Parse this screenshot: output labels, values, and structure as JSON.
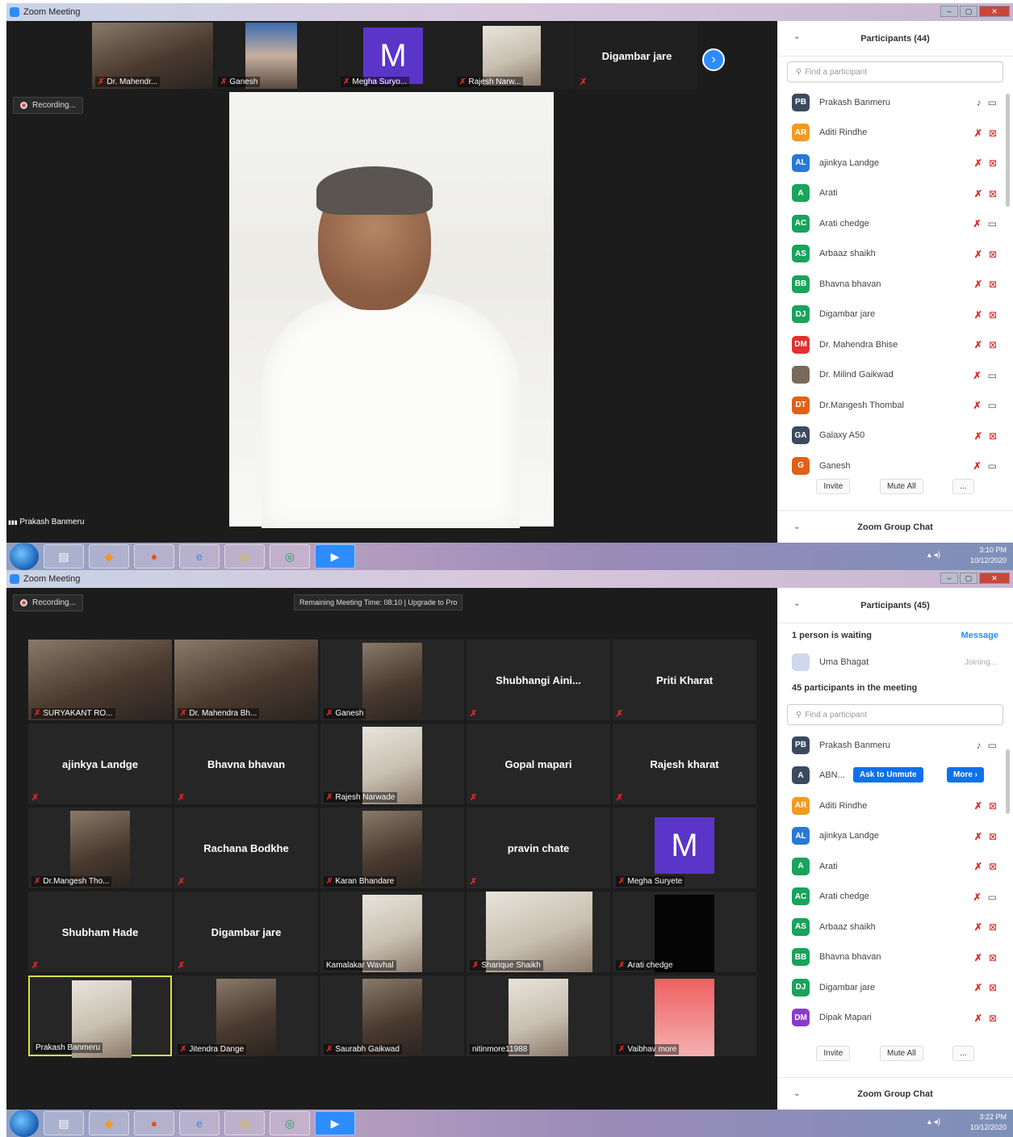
{
  "window_title": "Zoom Meeting",
  "window_controls": {
    "minimize": "–",
    "maximize": "▢",
    "close": "✕"
  },
  "taskbar": {
    "apps": [
      "start-orb",
      "file-manager",
      "vlc",
      "firefox",
      "internet-explorer",
      "chrome",
      "chrome-2",
      "zoom"
    ],
    "icons": {
      "file_manager": "▤",
      "vlc": "◆",
      "firefox": "●",
      "ie": "e",
      "chrome": "◎",
      "chrome2": "◎",
      "zoom": "▶"
    },
    "tray": "▴ ◂)",
    "clock1": {
      "time": "3:10 PM",
      "date": "10/12/2020"
    },
    "clock2": {
      "time": "3:22 PM",
      "date": "10/12/2020"
    }
  },
  "shot1": {
    "recording": "Recording...",
    "strip_tiles": [
      {
        "name": "Dr. Mahendr..."
      },
      {
        "name": "Ganesh"
      },
      {
        "name": "Megha Suryo..."
      },
      {
        "name": "Rajesh Narw..."
      },
      {
        "name": "Digambar jare"
      }
    ],
    "avatar_letter": "M",
    "next_icon": "›",
    "active_speaker": "Prakash Banmeru",
    "signal_icon": "▮▮▮",
    "panel": {
      "title": "Participants (44)",
      "search_placeholder": "Find a participant",
      "participants": [
        {
          "initials": "PB",
          "name": "Prakash Banmeru",
          "color": "#3b4a5e",
          "mic": "on",
          "video": "on"
        },
        {
          "initials": "AR",
          "name": "Aditi Rindhe",
          "color": "#f29a1f",
          "mic": "off",
          "video": "off"
        },
        {
          "initials": "AL",
          "name": "ajinkya Landge",
          "color": "#2779d4",
          "mic": "off",
          "video": "off"
        },
        {
          "initials": "A",
          "name": "Arati",
          "color": "#19a35b",
          "mic": "off",
          "video": "off"
        },
        {
          "initials": "AC",
          "name": "Arati chedge",
          "color": "#19a35b",
          "mic": "off",
          "video": "on"
        },
        {
          "initials": "AS",
          "name": "Arbaaz shaikh",
          "color": "#19a35b",
          "mic": "off",
          "video": "off"
        },
        {
          "initials": "BB",
          "name": "Bhavna bhavan",
          "color": "#19a35b",
          "mic": "off",
          "video": "off"
        },
        {
          "initials": "DJ",
          "name": "Digambar jare",
          "color": "#19a35b",
          "mic": "off",
          "video": "off"
        },
        {
          "initials": "DM",
          "name": "Dr. Mahendra Bhise",
          "color": "#e03030",
          "mic": "off",
          "video": "off"
        },
        {
          "initials": "",
          "name": "Dr. Milind Gaikwad",
          "color": "#7a6a5a",
          "mic": "off",
          "video": "on"
        },
        {
          "initials": "DT",
          "name": "Dr.Mangesh Thombal",
          "color": "#e06018",
          "mic": "off",
          "video": "on"
        },
        {
          "initials": "GA",
          "name": "Galaxy A50",
          "color": "#3b4a5e",
          "mic": "off",
          "video": "off"
        },
        {
          "initials": "G",
          "name": "Ganesh",
          "color": "#e06018",
          "mic": "off",
          "video": "on"
        }
      ],
      "invite": "Invite",
      "mute_all": "Mute All",
      "more": "...",
      "chat": "Zoom Group Chat"
    }
  },
  "shot2": {
    "recording": "Recording...",
    "remaining": "Remaining Meeting Time: 08:10 | Upgrade to Pro",
    "grid": [
      {
        "name": "SURYAKANT RO...",
        "type": "photo",
        "style": "",
        "mic": "off"
      },
      {
        "name": "Dr. Mahendra Bh...",
        "type": "photo",
        "style": "",
        "mic": "off"
      },
      {
        "name": "Ganesh",
        "type": "photo-small",
        "style": "",
        "mic": "off"
      },
      {
        "name": "Shubhangi Aini...",
        "type": "name",
        "mic": "off"
      },
      {
        "name": "Priti Kharat",
        "type": "name",
        "mic": "off"
      },
      {
        "name": "ajinkya Landge",
        "type": "name",
        "mic": "off"
      },
      {
        "name": "Bhavna bhavan",
        "type": "name",
        "mic": "off"
      },
      {
        "name": "Rajesh Narwade",
        "type": "photo-small",
        "style": "light",
        "mic": "off"
      },
      {
        "name": "Gopal mapari",
        "type": "name",
        "mic": "off"
      },
      {
        "name": "Rajesh kharat",
        "type": "name",
        "mic": "off"
      },
      {
        "name": "Dr.Mangesh Tho...",
        "type": "photo-small",
        "style": "",
        "mic": "off"
      },
      {
        "name": "Rachana Bodkhe",
        "type": "name",
        "mic": "off"
      },
      {
        "name": "Karan Bhandare",
        "type": "photo-small",
        "style": "",
        "mic": "off"
      },
      {
        "name": "pravin chate",
        "type": "name",
        "mic": "off"
      },
      {
        "name": "Megha Suryete",
        "type": "avatar",
        "mic": "off"
      },
      {
        "name": "Shubham Hade",
        "type": "name",
        "mic": "off"
      },
      {
        "name": "Digambar jare",
        "type": "name",
        "mic": "off"
      },
      {
        "name": "Kamalakar Wavhal",
        "type": "photo-small",
        "style": "light",
        "mic": "on"
      },
      {
        "name": "Sharique Shaikh",
        "type": "photo-wide",
        "style": "light",
        "mic": "off"
      },
      {
        "name": "Arati chedge",
        "type": "photo-small",
        "style": "dark",
        "mic": "off"
      },
      {
        "name": "Prakash Banmeru",
        "type": "photo-small",
        "style": "light",
        "mic": "on",
        "active": true
      },
      {
        "name": "Jitendra Dange",
        "type": "photo-small",
        "style": "",
        "mic": "off"
      },
      {
        "name": "Saurabh Gaikwad",
        "type": "photo-small",
        "style": "",
        "mic": "off"
      },
      {
        "name": "nitinmore11988",
        "type": "photo-small",
        "style": "light",
        "mic": "on"
      },
      {
        "name": "Vaibhav more",
        "type": "photo-small",
        "style": "red",
        "mic": "off"
      }
    ],
    "avatar_letter": "M",
    "panel": {
      "title": "Participants (45)",
      "waiting_label": "1 person is waiting",
      "message": "Message",
      "waiting_person": {
        "initials": "",
        "name": "Uma Bhagat",
        "status": "Joining..."
      },
      "in_meeting": "45 participants in the meeting",
      "search_placeholder": "Find a participant",
      "participants": [
        {
          "initials": "PB",
          "name": "Prakash Banmeru",
          "color": "#3b4a5e",
          "mic": "on",
          "video": "on"
        },
        {
          "initials": "A",
          "name": "ABN...",
          "color": "#3b4a5e",
          "special": true,
          "ask": "Ask to Unmute",
          "more": "More ›"
        },
        {
          "initials": "AR",
          "name": "Aditi Rindhe",
          "color": "#f29a1f",
          "mic": "off",
          "video": "off"
        },
        {
          "initials": "AL",
          "name": "ajinkya Landge",
          "color": "#2779d4",
          "mic": "off",
          "video": "off"
        },
        {
          "initials": "A",
          "name": "Arati",
          "color": "#19a35b",
          "mic": "off",
          "video": "off"
        },
        {
          "initials": "AC",
          "name": "Arati chedge",
          "color": "#19a35b",
          "mic": "off",
          "video": "on"
        },
        {
          "initials": "AS",
          "name": "Arbaaz shaikh",
          "color": "#19a35b",
          "mic": "off",
          "video": "off"
        },
        {
          "initials": "BB",
          "name": "Bhavna bhavan",
          "color": "#19a35b",
          "mic": "off",
          "video": "off"
        },
        {
          "initials": "DJ",
          "name": "Digambar jare",
          "color": "#19a35b",
          "mic": "off",
          "video": "off"
        },
        {
          "initials": "DM",
          "name": "Dipak Mapari",
          "color": "#8a3cc8",
          "mic": "off",
          "video": "off"
        }
      ],
      "invite": "Invite",
      "mute_all": "Mute All",
      "more": "...",
      "chat": "Zoom Group Chat"
    }
  }
}
